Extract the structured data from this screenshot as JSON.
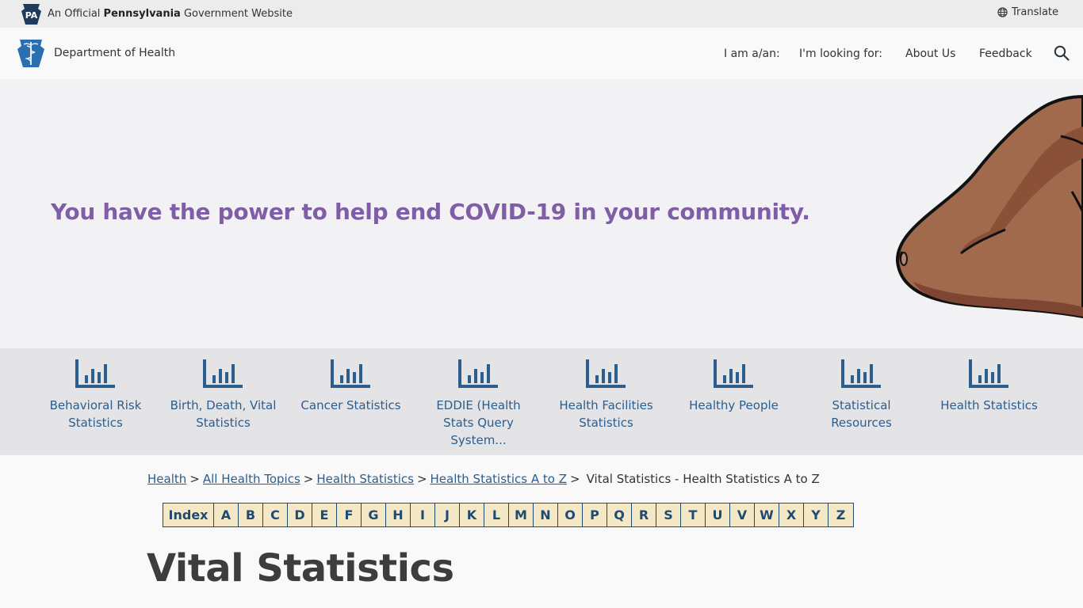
{
  "top_bar": {
    "badge": "PA",
    "official_prefix": "An Official",
    "state_name": "Pennsylvania",
    "official_suffix": "Government Website",
    "translate_label": "Translate",
    "translate_icon": "globe-icon"
  },
  "header": {
    "department_name": "Department of Health",
    "logo_icon": "keystone-caduceus-logo",
    "nav": [
      {
        "label": "I am a/an:"
      },
      {
        "label": "I'm looking for:"
      },
      {
        "label": "About Us"
      },
      {
        "label": "Feedback"
      }
    ],
    "search_icon": "search-icon"
  },
  "hero": {
    "headline": "You have the power to help end COVID-19 in your community."
  },
  "categories": [
    {
      "line1": "Behavioral Risk",
      "line2": "Statistics",
      "line3": ""
    },
    {
      "line1": "Birth, Death, Vital",
      "line2": "Statistics",
      "line3": ""
    },
    {
      "line1": "Cancer Statistics",
      "line2": "",
      "line3": ""
    },
    {
      "line1": "EDDIE (Health",
      "line2": "Stats Query",
      "line3": "System..."
    },
    {
      "line1": "Health Facilities",
      "line2": "Statistics",
      "line3": ""
    },
    {
      "line1": "Healthy People",
      "line2": "",
      "line3": ""
    },
    {
      "line1": "Statistical",
      "line2": "Resources",
      "line3": ""
    },
    {
      "line1": "Health Statistics",
      "line2": "",
      "line3": ""
    }
  ],
  "breadcrumb": {
    "links": [
      "Health",
      "All Health Topics",
      "Health Statistics",
      "Health Statistics A to Z"
    ],
    "separator": ">",
    "current": "Vital Statistics - Health Statistics A to Z"
  },
  "az_index": [
    "Index",
    "A",
    "B",
    "C",
    "D",
    "E",
    "F",
    "G",
    "H",
    "I",
    "J",
    "K",
    "L",
    "M",
    "N",
    "O",
    "P",
    "Q",
    "R",
    "S",
    "T",
    "U",
    "V",
    "W",
    "X",
    "Y",
    "Z"
  ],
  "page_title": "Vital Statistics",
  "colors": {
    "brand_blue": "#2b5d8d",
    "hero_purple": "#7f5ea7",
    "az_fill": "#f5e8c7",
    "az_border": "#1f4a72"
  }
}
